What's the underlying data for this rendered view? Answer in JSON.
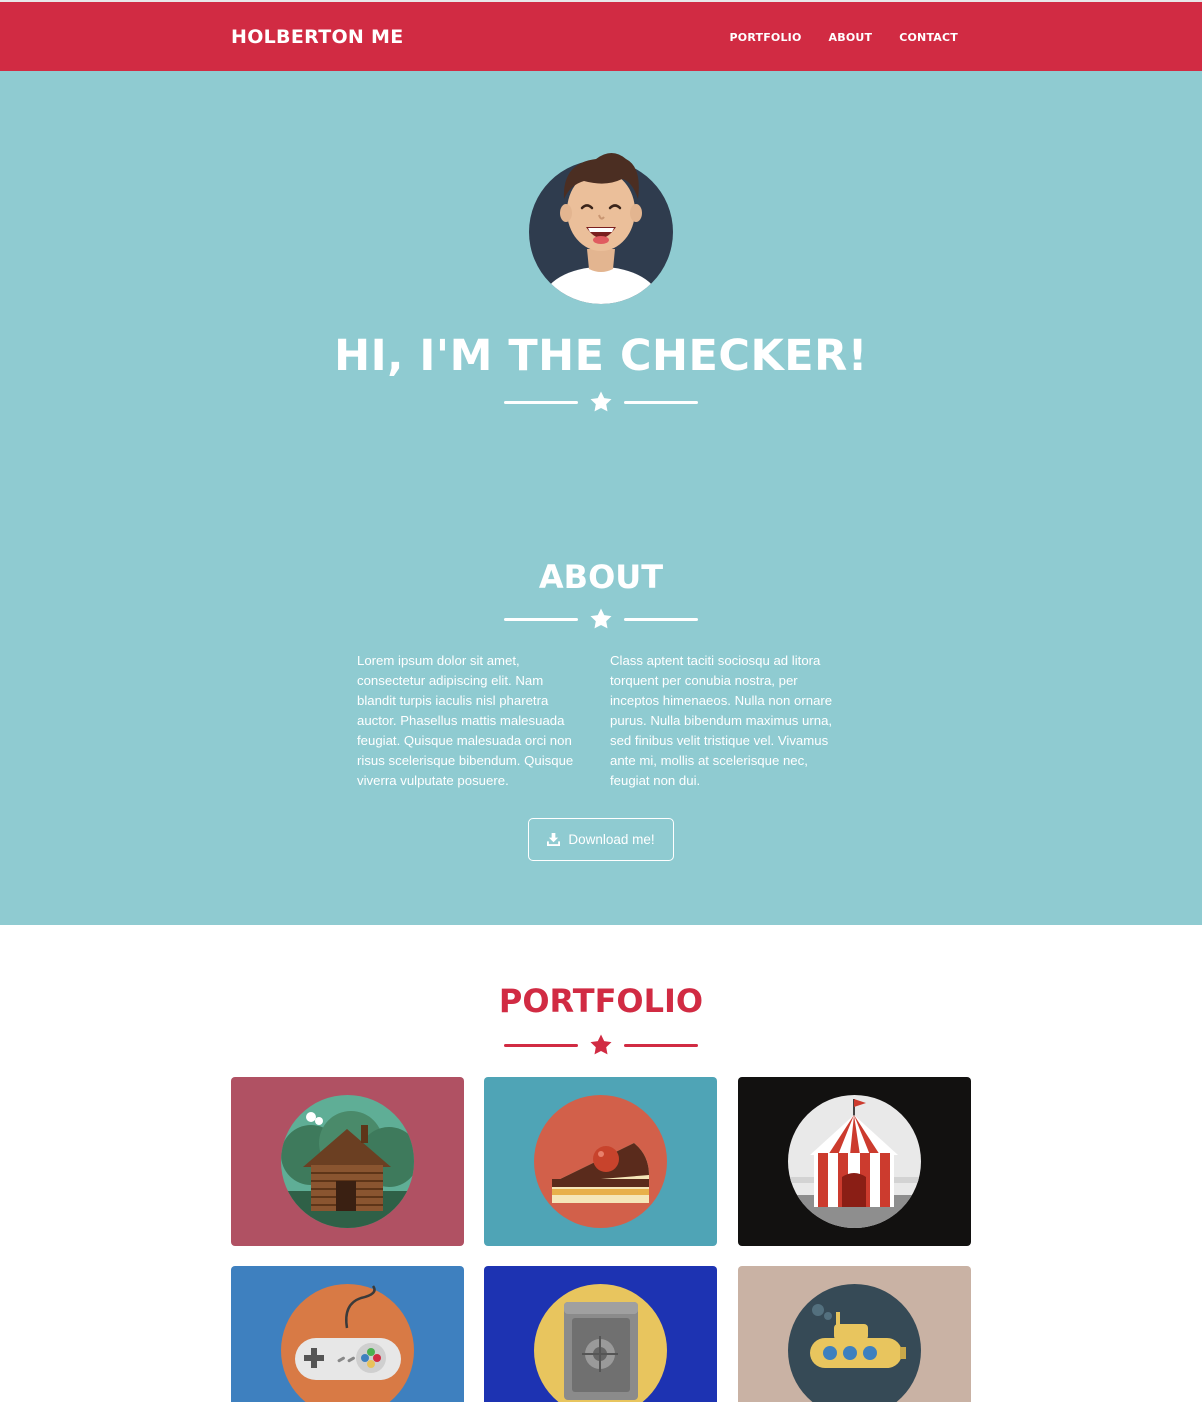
{
  "nav": {
    "brand": "HOLBERTON ME",
    "links": [
      "PORTFOLIO",
      "ABOUT",
      "CONTACT"
    ]
  },
  "hero": {
    "title": "HI, I'M THE CHECKER!"
  },
  "about": {
    "title": "ABOUT",
    "left_text": "Lorem ipsum dolor sit amet, consectetur adipiscing elit. Nam blandit turpis iaculis nisl pharetra auctor. Phasellus mattis malesuada feugiat. Quisque malesuada orci non risus scelerisque bibendum. Quisque viverra vulputate posuere.",
    "right_text": "Class aptent taciti sociosqu ad litora torquent per conubia nostra, per inceptos himenaeos. Nulla non ornare purus. Nulla bibendum maximus urna, sed finibus velit tristique vel. Vivamus ante mi, mollis at scelerisque nec, feugiat non dui.",
    "button_label": "Download me!"
  },
  "portfolio": {
    "title": "PORTFOLIO",
    "items": [
      {
        "icon": "cabin-icon",
        "bg": "#b05163"
      },
      {
        "icon": "cake-icon",
        "bg": "#4fa4b6"
      },
      {
        "icon": "circus-tent-icon",
        "bg": "#121110"
      },
      {
        "icon": "game-controller-icon",
        "bg": "#3e80bf"
      },
      {
        "icon": "safe-icon",
        "bg": "#1d33b2"
      },
      {
        "icon": "submarine-icon",
        "bg": "#c9b2a4"
      }
    ]
  },
  "colors": {
    "primary": "#d12b43",
    "hero_bg": "#8fcbd1",
    "text_light": "#ffffff"
  }
}
